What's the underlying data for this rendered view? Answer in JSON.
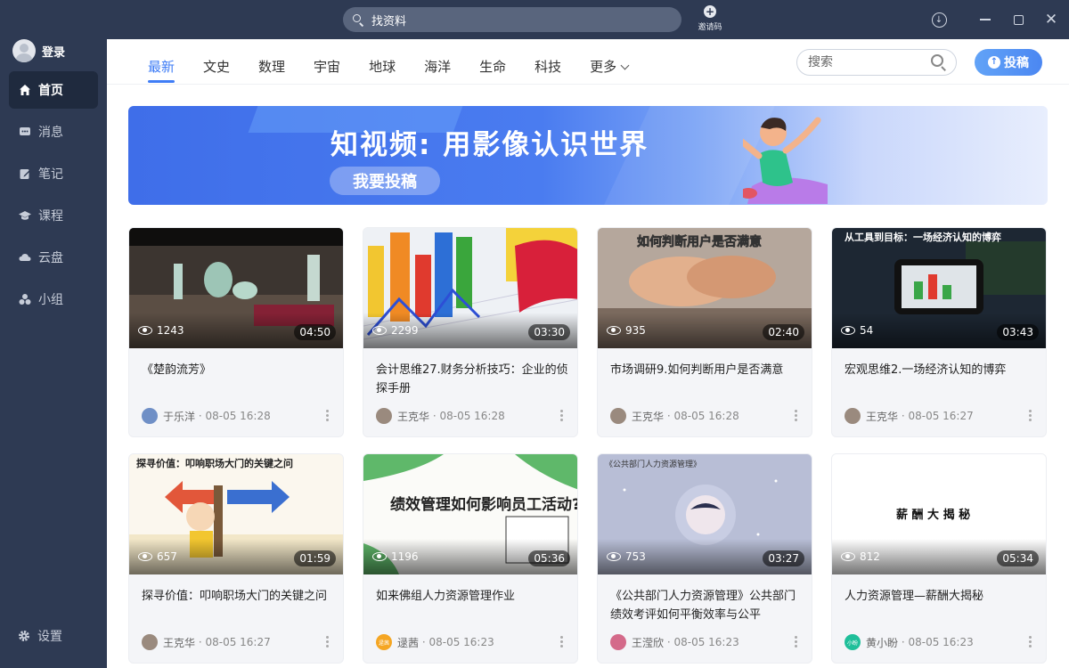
{
  "titlebar": {
    "search_text": "找资料",
    "invite_label": "邀请码"
  },
  "sidebar": {
    "login_label": "登录",
    "items": [
      {
        "label": "首页",
        "icon": "home-icon",
        "active": true
      },
      {
        "label": "消息",
        "icon": "message-icon"
      },
      {
        "label": "笔记",
        "icon": "note-icon"
      },
      {
        "label": "课程",
        "icon": "course-icon"
      },
      {
        "label": "云盘",
        "icon": "cloud-icon"
      },
      {
        "label": "小组",
        "icon": "group-icon"
      }
    ],
    "settings_label": "设置"
  },
  "header": {
    "categories": [
      "最新",
      "文史",
      "数理",
      "宇宙",
      "地球",
      "海洋",
      "生命",
      "科技",
      "更多"
    ],
    "active_category": "最新",
    "search_placeholder": "搜索",
    "submit_label": "投稿",
    "accent_color": "#3f7df6"
  },
  "banner": {
    "headline": "知视频: 用影像认识世界",
    "cta": "我要投稿"
  },
  "videos": [
    {
      "views": "1243",
      "duration": "04:50",
      "title": "《楚韵流芳》",
      "author": "于乐洋",
      "time": "08-05 16:28"
    },
    {
      "views": "2299",
      "duration": "03:30",
      "title": "会计思维27.财务分析技巧：企业的侦探手册",
      "author": "王克华",
      "time": "08-05 16:28"
    },
    {
      "views": "935",
      "duration": "02:40",
      "title": "市场调研9.如何判断用户是否满意",
      "author": "王克华",
      "time": "08-05 16:28"
    },
    {
      "views": "54",
      "duration": "03:43",
      "title": "宏观思维2.一场经济认知的博弈",
      "author": "王克华",
      "time": "08-05 16:27"
    },
    {
      "views": "657",
      "duration": "01:59",
      "title": "探寻价值：叩响职场大门的关键之问",
      "author": "王克华",
      "time": "08-05 16:27"
    },
    {
      "views": "1196",
      "duration": "05:36",
      "title": "如来佛组人力资源管理作业",
      "author": "逯茜",
      "time": "08-05 16:23"
    },
    {
      "views": "753",
      "duration": "03:27",
      "title": "《公共部门人力资源管理》公共部门绩效考评如何平衡效率与公平",
      "author": "王滢欣",
      "time": "08-05 16:23"
    },
    {
      "views": "812",
      "duration": "05:34",
      "title": "人力资源管理—薪酬大揭秘",
      "author": "黄小盼",
      "time": "08-05 16:23"
    }
  ],
  "thumb_texts": {
    "v3": "如何判断用户是否满意",
    "v4": "从工具到目标：一场经济认知的博弈",
    "v5": "探寻价值：叩响职场大门的关键之问",
    "v6": "绩效管理如何影响员工活动?",
    "v7": "《公共部门人力资源管理》",
    "v8": "薪 酬 大 揭 秘"
  },
  "avatar_texts": {
    "v6": "逯茜",
    "v8": "小盼"
  }
}
